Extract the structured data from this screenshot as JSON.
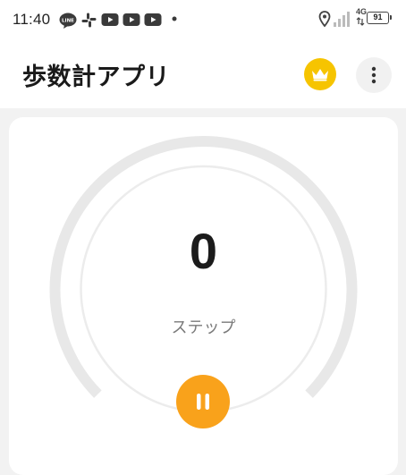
{
  "status_bar": {
    "time": "11:40",
    "notifications": [
      "line-icon",
      "slack-icon",
      "youtube-icon",
      "youtube-icon",
      "youtube-icon",
      "dot-icon"
    ],
    "network": "4G",
    "battery": "91"
  },
  "header": {
    "title": "歩数計アプリ",
    "crown_icon": "crown-icon",
    "menu_icon": "more-vert-icon"
  },
  "counter": {
    "steps": "0",
    "unit": "ステップ",
    "progress": 0,
    "pause_icon": "pause-icon"
  },
  "colors": {
    "accent": "#f9a21b",
    "crown": "#f6c400",
    "track": "#e8e8e8",
    "background": "#f2f2f2"
  }
}
